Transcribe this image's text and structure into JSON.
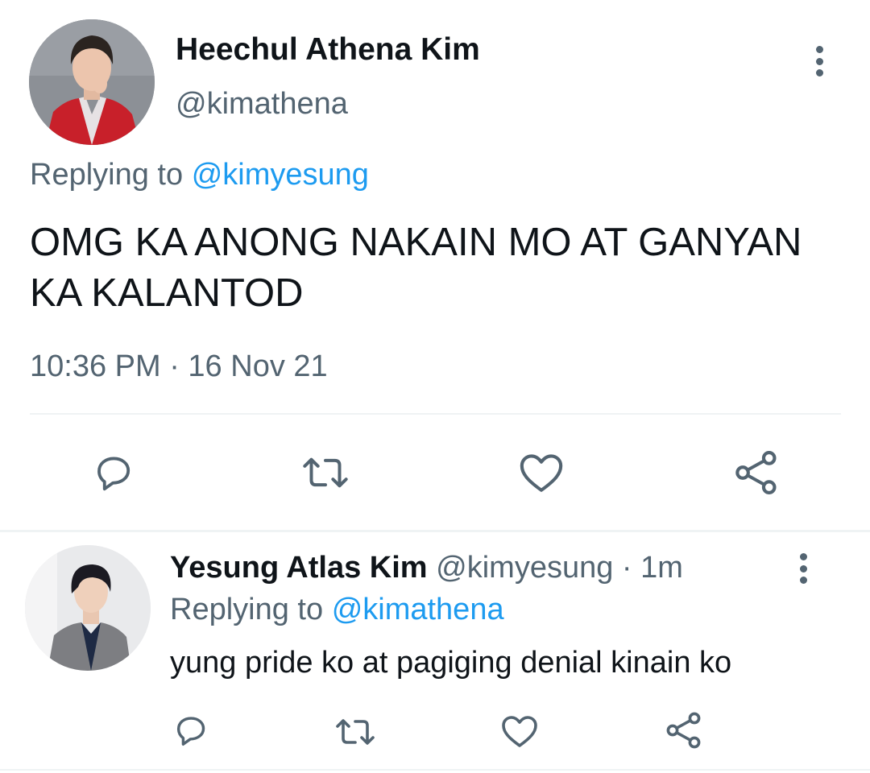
{
  "main_tweet": {
    "display_name": "Heechul Athena Kim",
    "handle": "@kimathena",
    "replying_prefix": "Replying to",
    "replying_to": "@kimyesung",
    "text": "OMG KA ANONG NAKAIN MO AT GANYAN KA KALANTOD",
    "timestamp": "10:36 PM · 16 Nov 21",
    "actions": [
      "reply-icon",
      "retweet-icon",
      "like-icon",
      "share-icon"
    ]
  },
  "reply_tweet": {
    "display_name": "Yesung Atlas Kim",
    "handle": "@kimyesung",
    "separator": " · ",
    "time_ago": "1m",
    "replying_prefix": "Replying to",
    "replying_to": "@kimathena",
    "text": "yung pride ko at pagiging denial kinain ko",
    "actions": [
      "reply-icon",
      "retweet-icon",
      "like-icon",
      "share-icon"
    ]
  },
  "colors": {
    "primary_text": "#0f1419",
    "secondary_text": "#536471",
    "link": "#1d9bf0",
    "divider": "#eff3f4"
  }
}
